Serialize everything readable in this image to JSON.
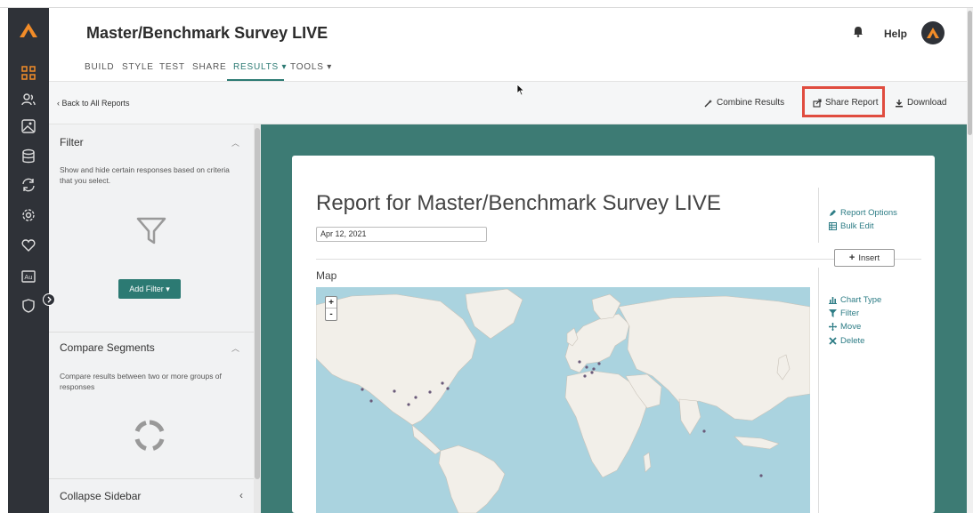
{
  "app": {
    "title": "Master/Benchmark Survey LIVE",
    "help_label": "Help",
    "accent_color": "#2c7a73",
    "brand_color": "#f28c28"
  },
  "tabs": [
    {
      "label": "BUILD"
    },
    {
      "label": "STYLE"
    },
    {
      "label": "TEST"
    },
    {
      "label": "SHARE"
    },
    {
      "label": "RESULTS ▾",
      "active": true
    },
    {
      "label": "TOOLS ▾"
    }
  ],
  "toolbar": {
    "back_label": "‹ Back to All Reports",
    "combine_label": "Combine Results",
    "share_label": "Share Report",
    "download_label": "Download"
  },
  "sidebar": {
    "filter": {
      "title": "Filter",
      "description": "Show and hide certain responses based on criteria that you select.",
      "add_button": "Add Filter ▾"
    },
    "compare": {
      "title": "Compare Segments",
      "description": "Compare results between two or more groups of responses"
    },
    "collapse_label": "Collapse Sidebar"
  },
  "report": {
    "title": "Report for Master/Benchmark Survey LIVE",
    "date_value": "Apr 12, 2021",
    "options_label": "Report Options",
    "bulk_edit_label": "Bulk Edit",
    "insert_label": "Insert",
    "map_label": "Map",
    "zoom_in": "+",
    "zoom_out": "-",
    "chart_actions": {
      "chart_type": "Chart Type",
      "filter": "Filter",
      "move": "Move",
      "delete": "Delete"
    }
  }
}
